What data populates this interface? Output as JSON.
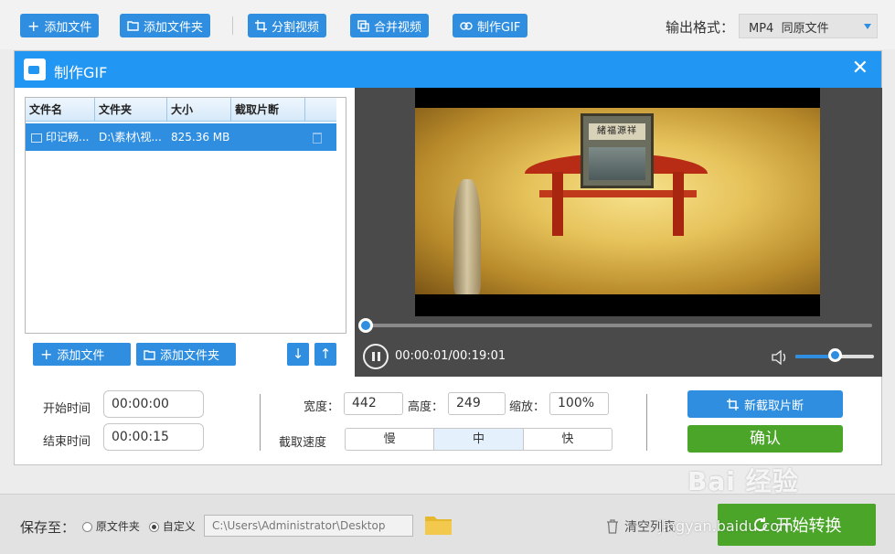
{
  "toolbar": {
    "add_file": "添加文件",
    "add_folder": "添加文件夹",
    "split_video": "分割视频",
    "merge_video": "合并视频",
    "make_gif": "制作GIF",
    "output_format_label": "输出格式：",
    "output_format_value": "MP4  同原文件"
  },
  "dialog": {
    "title": "制作GIF",
    "table": {
      "headers": [
        "文件名",
        "文件夹",
        "大小",
        "截取片断"
      ],
      "rows": [
        {
          "name": "印记畅...",
          "folder": "D:\\素材\\视...",
          "size": "825.36 MB",
          "clip": ""
        }
      ]
    },
    "add_file": "添加文件",
    "add_folder": "添加文件夹",
    "video": {
      "banner_text": "緒福源祥",
      "timecode": "00:00:01/00:19:01",
      "progress": 0.0009,
      "volume": 0.5
    },
    "start_time_label": "开始时间",
    "start_time": "00:00:00",
    "end_time_label": "结束时间",
    "end_time": "00:00:15",
    "width_label": "宽度：",
    "width": "442",
    "height_label": "高度：",
    "height": "249",
    "scale_label": "缩放：",
    "scale": "100%",
    "speed_label": "截取速度",
    "speed_options": [
      "慢",
      "中",
      "快"
    ],
    "speed_selected": "中",
    "new_clip": "新截取片断",
    "confirm": "确认"
  },
  "footer": {
    "save_to_label": "保存至：",
    "radio_source": "原文件夹",
    "radio_custom": "自定义",
    "custom_selected": true,
    "path": "C:\\Users\\Administrator\\Desktop",
    "clear_list": "清空列表",
    "start": "开始转换"
  },
  "watermark": {
    "brand": "Bai 经验",
    "url": "jingyan.baidu.com"
  },
  "colors": {
    "accent": "#2f8ee0",
    "title_bar": "#2196f3",
    "confirm_green": "#4aa529",
    "folder_yellow": "#e6b82e"
  }
}
